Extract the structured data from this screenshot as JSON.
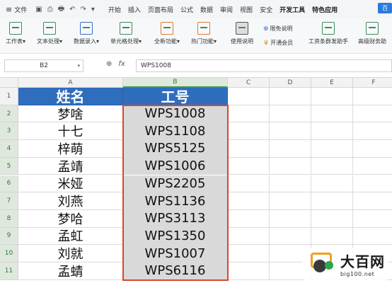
{
  "menubar": {
    "file_label": "文件",
    "menus": [
      "开始",
      "插入",
      "页面布局",
      "公式",
      "数据",
      "审阅",
      "视图",
      "安全",
      "开发工具",
      "特色应用"
    ],
    "active_tab_badge": "百"
  },
  "ribbon": {
    "buttons": [
      {
        "label": "工作表▾",
        "icon": "worksheet-icon"
      },
      {
        "label": "文本处理▾",
        "icon": "text-processing-icon"
      },
      {
        "label": "数据录入▾",
        "icon": "data-entry-icon"
      },
      {
        "label": "单元格处理▾",
        "icon": "cell-processing-icon"
      },
      {
        "label": "全新功能▾",
        "icon": "new-feature-icon"
      },
      {
        "label": "热门功能▾",
        "icon": "hot-feature-icon"
      },
      {
        "label": "使用说明",
        "icon": "manual-icon"
      },
      {
        "label": "工资条群发助手",
        "icon": "payroll-icon"
      },
      {
        "label": "高级财务助",
        "icon": "finance-icon"
      }
    ],
    "small_buttons": [
      {
        "label": "限免说明",
        "icon": "info-icon"
      },
      {
        "label": "开通会员",
        "icon": "crown-icon"
      }
    ]
  },
  "formula_bar": {
    "cell_ref": "B2",
    "fx_label": "fx",
    "value": "WPS1008"
  },
  "sheet": {
    "columns": [
      "A",
      "B",
      "C",
      "D",
      "E",
      "F"
    ],
    "rows": [
      "1",
      "2",
      "3",
      "4",
      "5",
      "6",
      "7",
      "8",
      "9",
      "10",
      "11"
    ],
    "header": [
      "姓名",
      "工号"
    ],
    "data": [
      [
        "梦啥",
        "WPS1008"
      ],
      [
        "十七",
        "WPS1108"
      ],
      [
        "梓萌",
        "WPS5125"
      ],
      [
        "孟靖",
        "WPS1006"
      ],
      [
        "米娅",
        "WPS2205"
      ],
      [
        "刘燕",
        "WPS1136"
      ],
      [
        "梦哈",
        "WPS3113"
      ],
      [
        "孟虹",
        "WPS1350"
      ],
      [
        "刘就",
        "WPS1007"
      ],
      [
        "孟蜻",
        "WPS6116"
      ]
    ]
  },
  "watermark": {
    "title": "大百网",
    "url": "big100.net"
  },
  "colors": {
    "header_fill": "#2f6dbd",
    "selection_border": "#d9462e",
    "selection_fill": "#d9d9d9"
  }
}
